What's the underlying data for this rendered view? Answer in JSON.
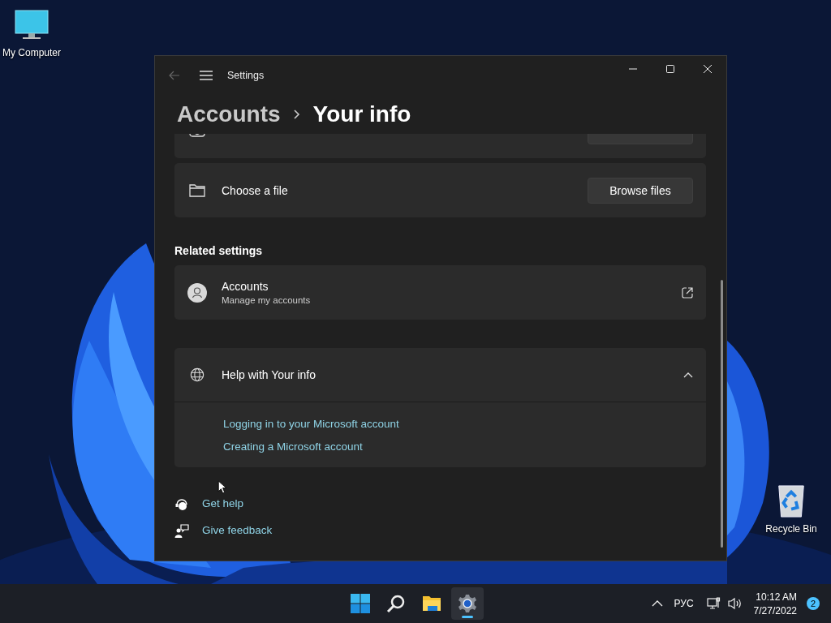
{
  "desktop": {
    "icons": [
      {
        "kind": "computer",
        "label": "My Computer"
      },
      {
        "kind": "recycle",
        "label": "Recycle Bin"
      }
    ]
  },
  "window": {
    "title": "Settings",
    "breadcrumb": [
      {
        "label": "Accounts",
        "selected": false
      },
      {
        "label": "Your info",
        "selected": true
      }
    ]
  },
  "photo_rows": [
    {
      "kind": "camera"
    },
    {
      "kind": "folder",
      "label": "Choose a file",
      "button": "Browse files"
    }
  ],
  "related_settings": {
    "heading": "Related settings",
    "items": [
      {
        "title": "Accounts",
        "subtitle": "Manage my accounts"
      }
    ]
  },
  "help": {
    "title": "Help with Your info",
    "expanded": true,
    "links": [
      {
        "label": "Logging in to your Microsoft account"
      },
      {
        "label": "Creating a Microsoft account"
      }
    ]
  },
  "footer_links": [
    {
      "kind": "help",
      "label": "Get help"
    },
    {
      "kind": "feedback",
      "label": "Give feedback"
    }
  ],
  "taskbar": {
    "apps": [
      {
        "kind": "start",
        "selected": false
      },
      {
        "kind": "search",
        "selected": false
      },
      {
        "kind": "explorer",
        "selected": false
      },
      {
        "kind": "settings",
        "selected": true
      }
    ],
    "language": "РУС",
    "time": "10:12 AM",
    "date": "7/27/2022",
    "notifications": "2"
  }
}
